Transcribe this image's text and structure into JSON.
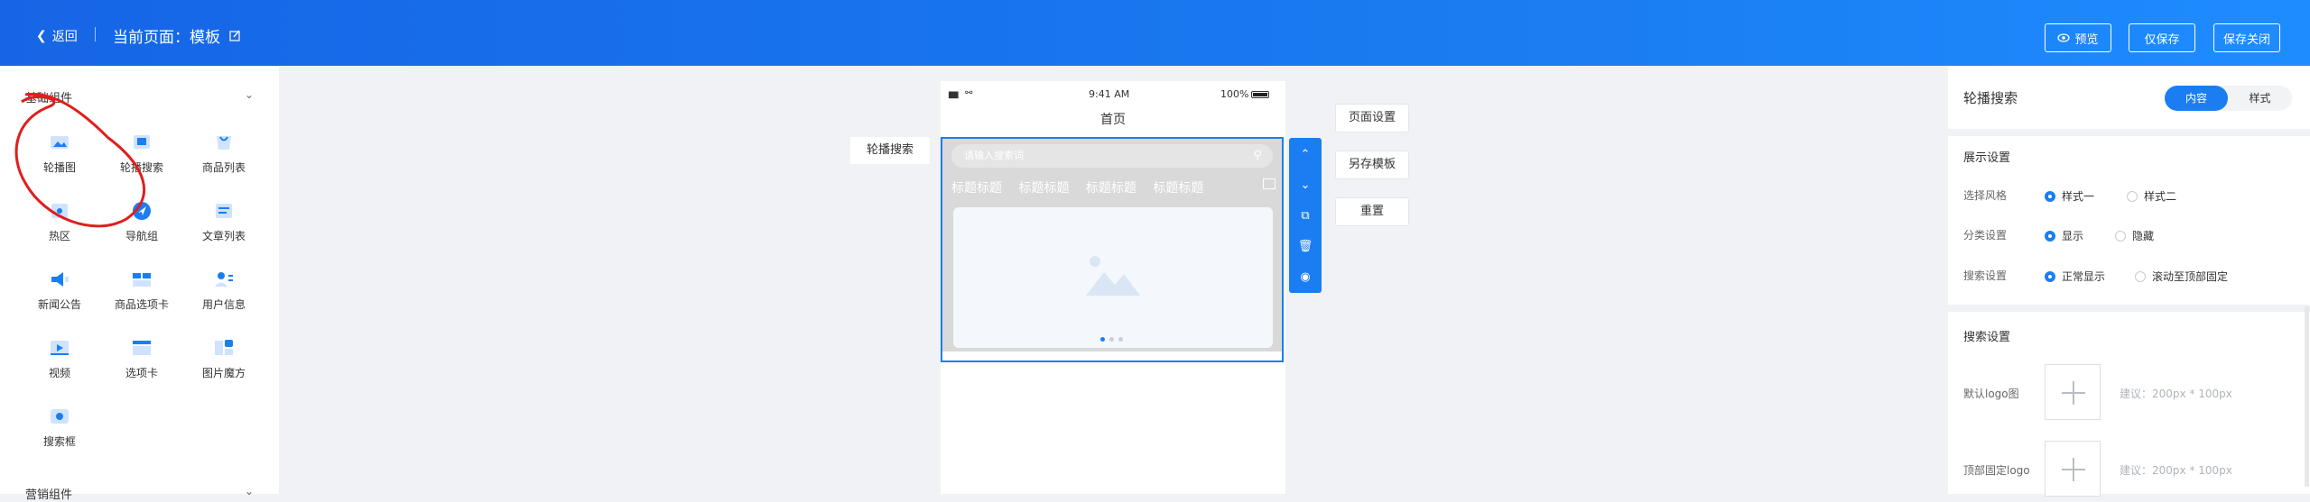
{
  "header": {
    "back_label": "返回",
    "current_page_label": "当前页面：模板",
    "preview_label": "预览",
    "save_only_label": "仅保存",
    "save_close_label": "保存关闭"
  },
  "left_panel": {
    "basic_group_title": "基础组件",
    "components": [
      {
        "label": "轮播图",
        "icon": "image-icon"
      },
      {
        "label": "轮播搜索",
        "icon": "carousel-search-icon"
      },
      {
        "label": "商品列表",
        "icon": "bag-icon"
      },
      {
        "label": "热区",
        "icon": "hotspot-icon"
      },
      {
        "label": "导航组",
        "icon": "navigation-icon"
      },
      {
        "label": "文章列表",
        "icon": "article-icon"
      },
      {
        "label": "新闻公告",
        "icon": "announcement-icon"
      },
      {
        "label": "商品选项卡",
        "icon": "product-tabs-icon"
      },
      {
        "label": "用户信息",
        "icon": "user-icon"
      },
      {
        "label": "视频",
        "icon": "video-icon"
      },
      {
        "label": "选项卡",
        "icon": "tabs-icon"
      },
      {
        "label": "图片魔方",
        "icon": "image-cube-icon"
      },
      {
        "label": "搜索框",
        "icon": "search-box-icon"
      }
    ],
    "marketing_group_title": "营销组件"
  },
  "canvas": {
    "status_time": "9:41 AM",
    "status_battery": "100%",
    "page_title": "首页",
    "search_placeholder": "请输入搜索词",
    "category_tabs": [
      "标题标题",
      "标题标题",
      "标题标题",
      "标题标题"
    ],
    "component_tag": "轮播搜索",
    "side_buttons": {
      "page_settings": "页面设置",
      "save_as_template": "另存模板",
      "reset": "重置"
    }
  },
  "right_panel": {
    "title": "轮播搜索",
    "tab_content": "内容",
    "tab_style": "样式",
    "display_section": "展示设置",
    "style_label": "选择风格",
    "style_options": [
      "样式一",
      "样式二"
    ],
    "category_label": "分类设置",
    "category_options": [
      "显示",
      "隐藏"
    ],
    "search_label": "搜索设置",
    "search_options": [
      "正常显示",
      "滚动至顶部固定"
    ],
    "search_section": "搜索设置",
    "default_logo_label": "默认logo图",
    "default_logo_hint": "建议：200px * 100px",
    "fixed_logo_label": "顶部固定logo",
    "fixed_logo_hint": "建议：200px * 100px"
  },
  "colors": {
    "primary": "#1a7ef2",
    "annotation": "#e01e1e"
  }
}
